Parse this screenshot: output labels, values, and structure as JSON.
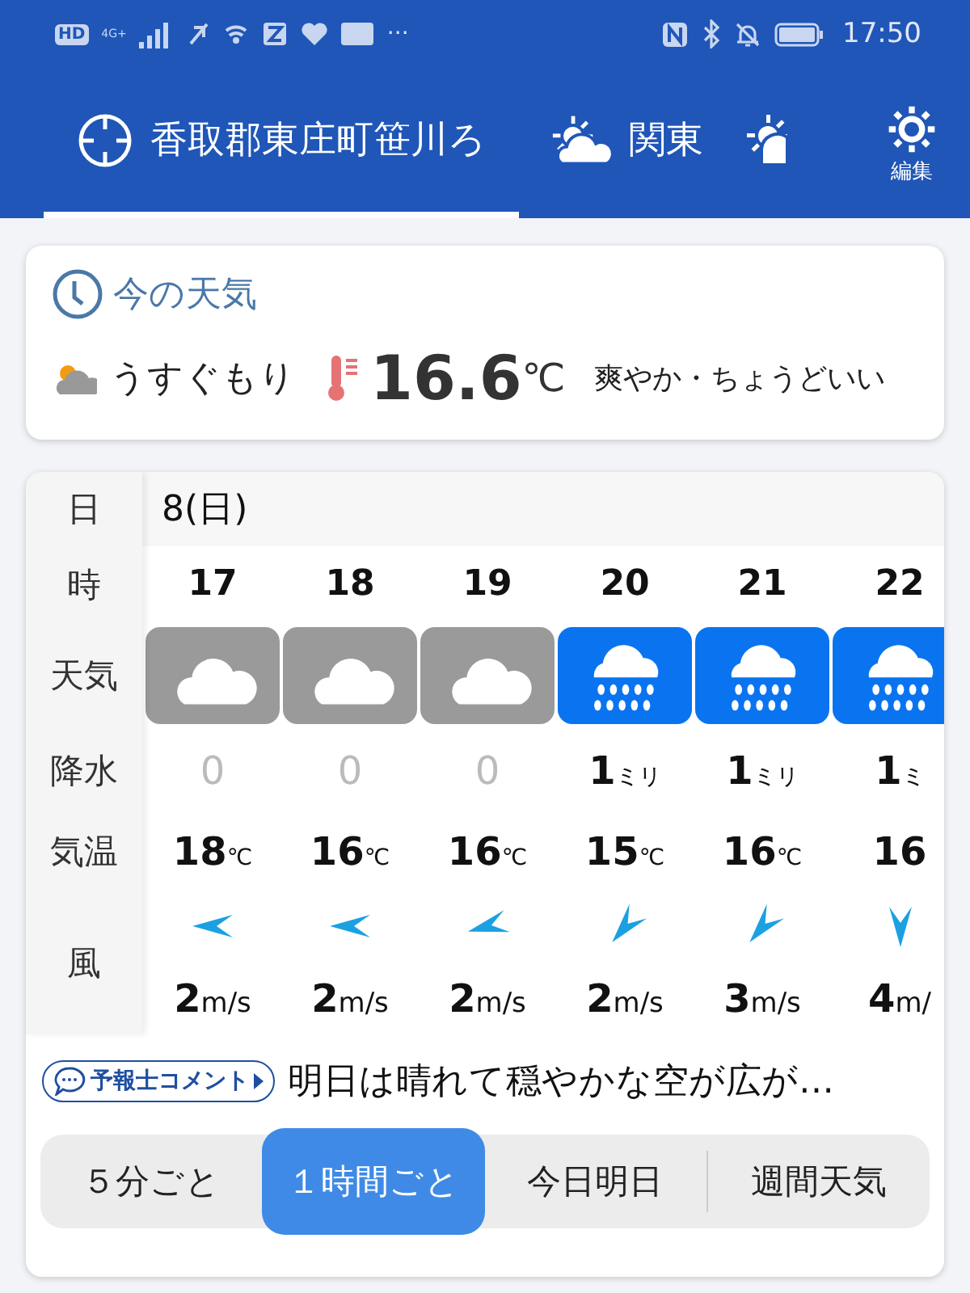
{
  "status_bar": {
    "badge": "HD",
    "network": "4G+",
    "more": "···",
    "time": "17:50"
  },
  "header": {
    "tabs": [
      {
        "kind": "location",
        "label": "香取郡東庄町笹川ろ",
        "selected": true
      },
      {
        "kind": "region",
        "label": "関東",
        "selected": false
      },
      {
        "kind": "partial",
        "selected": false
      }
    ],
    "settings_label": "編集"
  },
  "current": {
    "title": "今の天気",
    "condition": "うすぐもり",
    "temperature": "16.6",
    "unit": "℃",
    "feeling": "爽やか・ちょうどいい"
  },
  "forecast": {
    "row_labels": [
      "日",
      "時",
      "天気",
      "降水",
      "気温",
      "風"
    ],
    "day": "8(日)",
    "columns": [
      {
        "hour": "17",
        "weather": {
          "kind": "cloudy"
        },
        "precip": "0",
        "temp": "18",
        "temp_unit": "℃",
        "wind_arrow": {
          "kind": "east"
        },
        "wind": "2",
        "wind_unit": "m/s"
      },
      {
        "hour": "18",
        "weather": {
          "kind": "cloudy"
        },
        "precip": "0",
        "temp": "16",
        "temp_unit": "℃",
        "wind_arrow": {
          "kind": "east"
        },
        "wind": "2",
        "wind_unit": "m/s"
      },
      {
        "hour": "19",
        "weather": {
          "kind": "cloudy"
        },
        "precip": "0",
        "temp": "16",
        "temp_unit": "℃",
        "wind_arrow": {
          "kind": "eastnortheast"
        },
        "wind": "2",
        "wind_unit": "m/s"
      },
      {
        "hour": "20",
        "weather": {
          "kind": "rain"
        },
        "precip": "1",
        "precip_unit": "ミリ",
        "temp": "15",
        "temp_unit": "℃",
        "wind_arrow": {
          "kind": "northeast"
        },
        "wind": "2",
        "wind_unit": "m/s"
      },
      {
        "hour": "21",
        "weather": {
          "kind": "rain"
        },
        "precip": "1",
        "precip_unit": "ミリ",
        "temp": "16",
        "temp_unit": "℃",
        "wind_arrow": {
          "kind": "northeast"
        },
        "wind": "3",
        "wind_unit": "m/s"
      },
      {
        "hour": "22",
        "weather": {
          "kind": "rain"
        },
        "precip": "1",
        "precip_unit": "ミ",
        "temp": "16",
        "wind_arrow": {
          "kind": "north"
        },
        "wind": "4",
        "wind_unit": "m/"
      }
    ]
  },
  "comment": {
    "badge": "予報士コメント",
    "text": "明日は晴れて穏やかな空が広が…"
  },
  "modes": [
    {
      "label": "５分ごと",
      "selected": false
    },
    {
      "label": "１時間ごと",
      "selected": true
    },
    {
      "label": "今日明日",
      "selected": false
    },
    {
      "label": "週間天気",
      "selected": false
    }
  ]
}
